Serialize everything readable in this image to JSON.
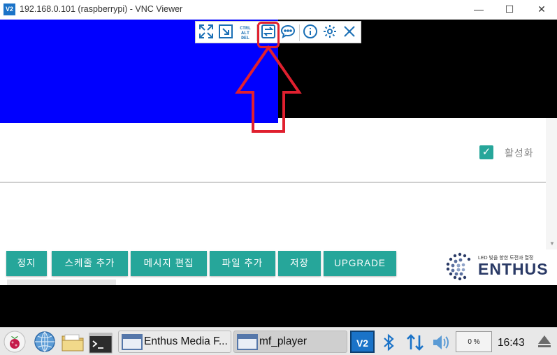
{
  "window": {
    "logo": "V2",
    "title": "192.168.0.101 (raspberrypi) - VNC Viewer",
    "minimize": "—",
    "maximize": "☐",
    "close": "✕"
  },
  "vnc_toolbar": {
    "cad_label": "CTRL\nALT\nDEL",
    "icons": [
      "fullscreen-icon",
      "scale-icon",
      "ctrl-alt-del-icon",
      "transfer-files-icon",
      "chat-icon",
      "info-icon",
      "settings-icon",
      "close-icon"
    ]
  },
  "panel": {
    "checkbox_label": "활성화",
    "checked": true
  },
  "buttons": [
    {
      "label": "정지"
    },
    {
      "label": "스케줄 추가"
    },
    {
      "label": "메시지 편집"
    },
    {
      "label": "파일 추가"
    },
    {
      "label": "저장"
    },
    {
      "label": "UPGRADE"
    }
  ],
  "logo": {
    "tagline": "LED 빛을 향한 도전과 열정",
    "word": "ENTHUS"
  },
  "taskbar": {
    "tasks": [
      {
        "label": "Enthus Media F..."
      },
      {
        "label": "mf_player"
      }
    ],
    "cpu": "0 %",
    "clock": "16:43"
  },
  "colors": {
    "accent": "#26a69a",
    "vnc_blue": "#1a73c8",
    "highlight": "#e0202f"
  }
}
